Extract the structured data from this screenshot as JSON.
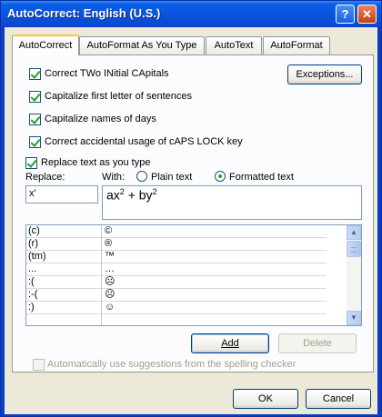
{
  "window": {
    "title": "AutoCorrect: English (U.S.)"
  },
  "titlebar": {
    "help_glyph": "?",
    "close_glyph": "✕"
  },
  "tabs": [
    {
      "label": "AutoCorrect",
      "active": true
    },
    {
      "label": "AutoFormat As You Type",
      "active": false
    },
    {
      "label": "AutoText",
      "active": false
    },
    {
      "label": "AutoFormat",
      "active": false
    }
  ],
  "options": [
    {
      "label": "Correct TWo INitial CApitals",
      "checked": true
    },
    {
      "label": "Capitalize first letter of sentences",
      "checked": true
    },
    {
      "label": "Capitalize names of days",
      "checked": true
    },
    {
      "label": "Correct accidental usage of cAPS LOCK key",
      "checked": true
    }
  ],
  "exceptions_button": "Exceptions...",
  "replace_group": {
    "label": "Replace text as you type",
    "checked": true,
    "replace_label": "Replace:",
    "with_label": "With:",
    "plain_text": "Plain text",
    "formatted_text": "Formatted text",
    "selected_mode": "formatted",
    "replace_value": "x'",
    "with_value": {
      "base1": "ax",
      "sup1": "2",
      "mid": " + by",
      "sup2": "2"
    }
  },
  "entries": [
    {
      "replace": "(c)",
      "with": "©"
    },
    {
      "replace": "(r)",
      "with": "®"
    },
    {
      "replace": "(tm)",
      "with": "™"
    },
    {
      "replace": "...",
      "with": "…"
    },
    {
      "replace": ":(",
      "with": "☹"
    },
    {
      "replace": ":-(",
      "with": "☹"
    },
    {
      "replace": ":)",
      "with": "☺"
    }
  ],
  "scroll": {
    "up": "▲",
    "down": "▼"
  },
  "add_button": "Add",
  "delete_button": "Delete",
  "suggestions": {
    "label": "Automatically use suggestions from the spelling checker",
    "checked": false,
    "enabled": false
  },
  "ok_button": "OK",
  "cancel_button": "Cancel",
  "colors": {
    "title_blue": "#0a53df",
    "face": "#ece9d8",
    "check_green": "#21a121",
    "tab_highlight": "#ffc83c"
  }
}
